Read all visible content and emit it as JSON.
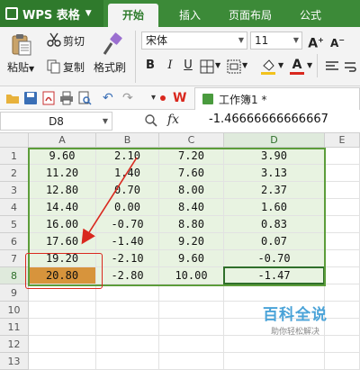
{
  "app": {
    "menu_label": "WPS 表格"
  },
  "tabs": [
    {
      "label": "开始",
      "active": true
    },
    {
      "label": "插入",
      "active": false
    },
    {
      "label": "页面布局",
      "active": false
    },
    {
      "label": "公式",
      "active": false
    }
  ],
  "ribbon": {
    "paste": "粘贴",
    "cut": "剪切",
    "copy": "复制",
    "format_painter": "格式刷",
    "font_name": "宋体",
    "font_size": "11"
  },
  "qa": {
    "doc_tab": "工作簿1 *"
  },
  "formula_bar": {
    "name_box": "D8",
    "fx": "fx",
    "formula": "-1.46666666666667"
  },
  "sheet": {
    "columns": [
      "A",
      "B",
      "C",
      "D",
      "E"
    ],
    "rows": [
      "1",
      "2",
      "3",
      "4",
      "5",
      "6",
      "7",
      "8",
      "9",
      "10",
      "11",
      "12",
      "13"
    ],
    "data": [
      [
        "9.60",
        "2.10",
        "7.20",
        "3.90"
      ],
      [
        "11.20",
        "1.40",
        "7.60",
        "3.13"
      ],
      [
        "12.80",
        "0.70",
        "8.00",
        "2.37"
      ],
      [
        "14.40",
        "0.00",
        "8.40",
        "1.60"
      ],
      [
        "16.00",
        "-0.70",
        "8.80",
        "0.83"
      ],
      [
        "17.60",
        "-1.40",
        "9.20",
        "0.07"
      ],
      [
        "19.20",
        "-2.10",
        "9.60",
        "-0.70"
      ],
      [
        "20.80",
        "-2.80",
        "10.00",
        "-1.47"
      ]
    ],
    "active_cell": "D8",
    "highlight_cell": "A8"
  },
  "colors": {
    "title_green": "#3c8a38",
    "highlight": "#d7943c",
    "annotation_red": "#d9281e",
    "data_tint": "#e8f3e1"
  },
  "watermark": {
    "title": "百科全说",
    "subtitle": "助你轻松解决"
  }
}
